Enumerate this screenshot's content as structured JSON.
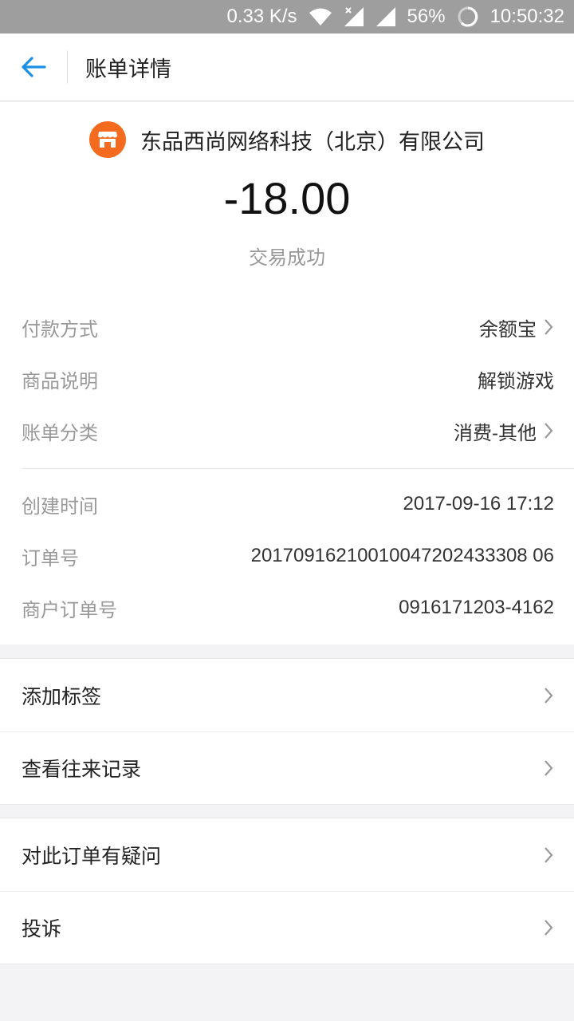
{
  "status_bar": {
    "net_speed": "0.33 K/s",
    "battery": "56%",
    "time": "10:50:32"
  },
  "header": {
    "title": "账单详情"
  },
  "summary": {
    "merchant": "东品西尚网络科技（北京）有限公司",
    "amount": "-18.00",
    "status": "交易成功"
  },
  "details": [
    {
      "label": "付款方式",
      "value": "余额宝"
    },
    {
      "label": "商品说明",
      "value": "解锁游戏"
    },
    {
      "label": "账单分类",
      "value": "消费-其他"
    }
  ],
  "order_info": [
    {
      "label": "创建时间",
      "value": "2017-09-16 17:12"
    },
    {
      "label": "订单号",
      "value": "20170916210010047202433308 06"
    },
    {
      "label": "商户订单号",
      "value": "0916171203-4162"
    }
  ],
  "menu_group1": [
    {
      "label": "添加标签"
    },
    {
      "label": "查看往来记录"
    }
  ],
  "menu_group2": [
    {
      "label": "对此订单有疑问"
    },
    {
      "label": "投诉"
    }
  ],
  "colors": {
    "accent": "#1a8fe3",
    "merchant_icon": "#f46a1f"
  }
}
